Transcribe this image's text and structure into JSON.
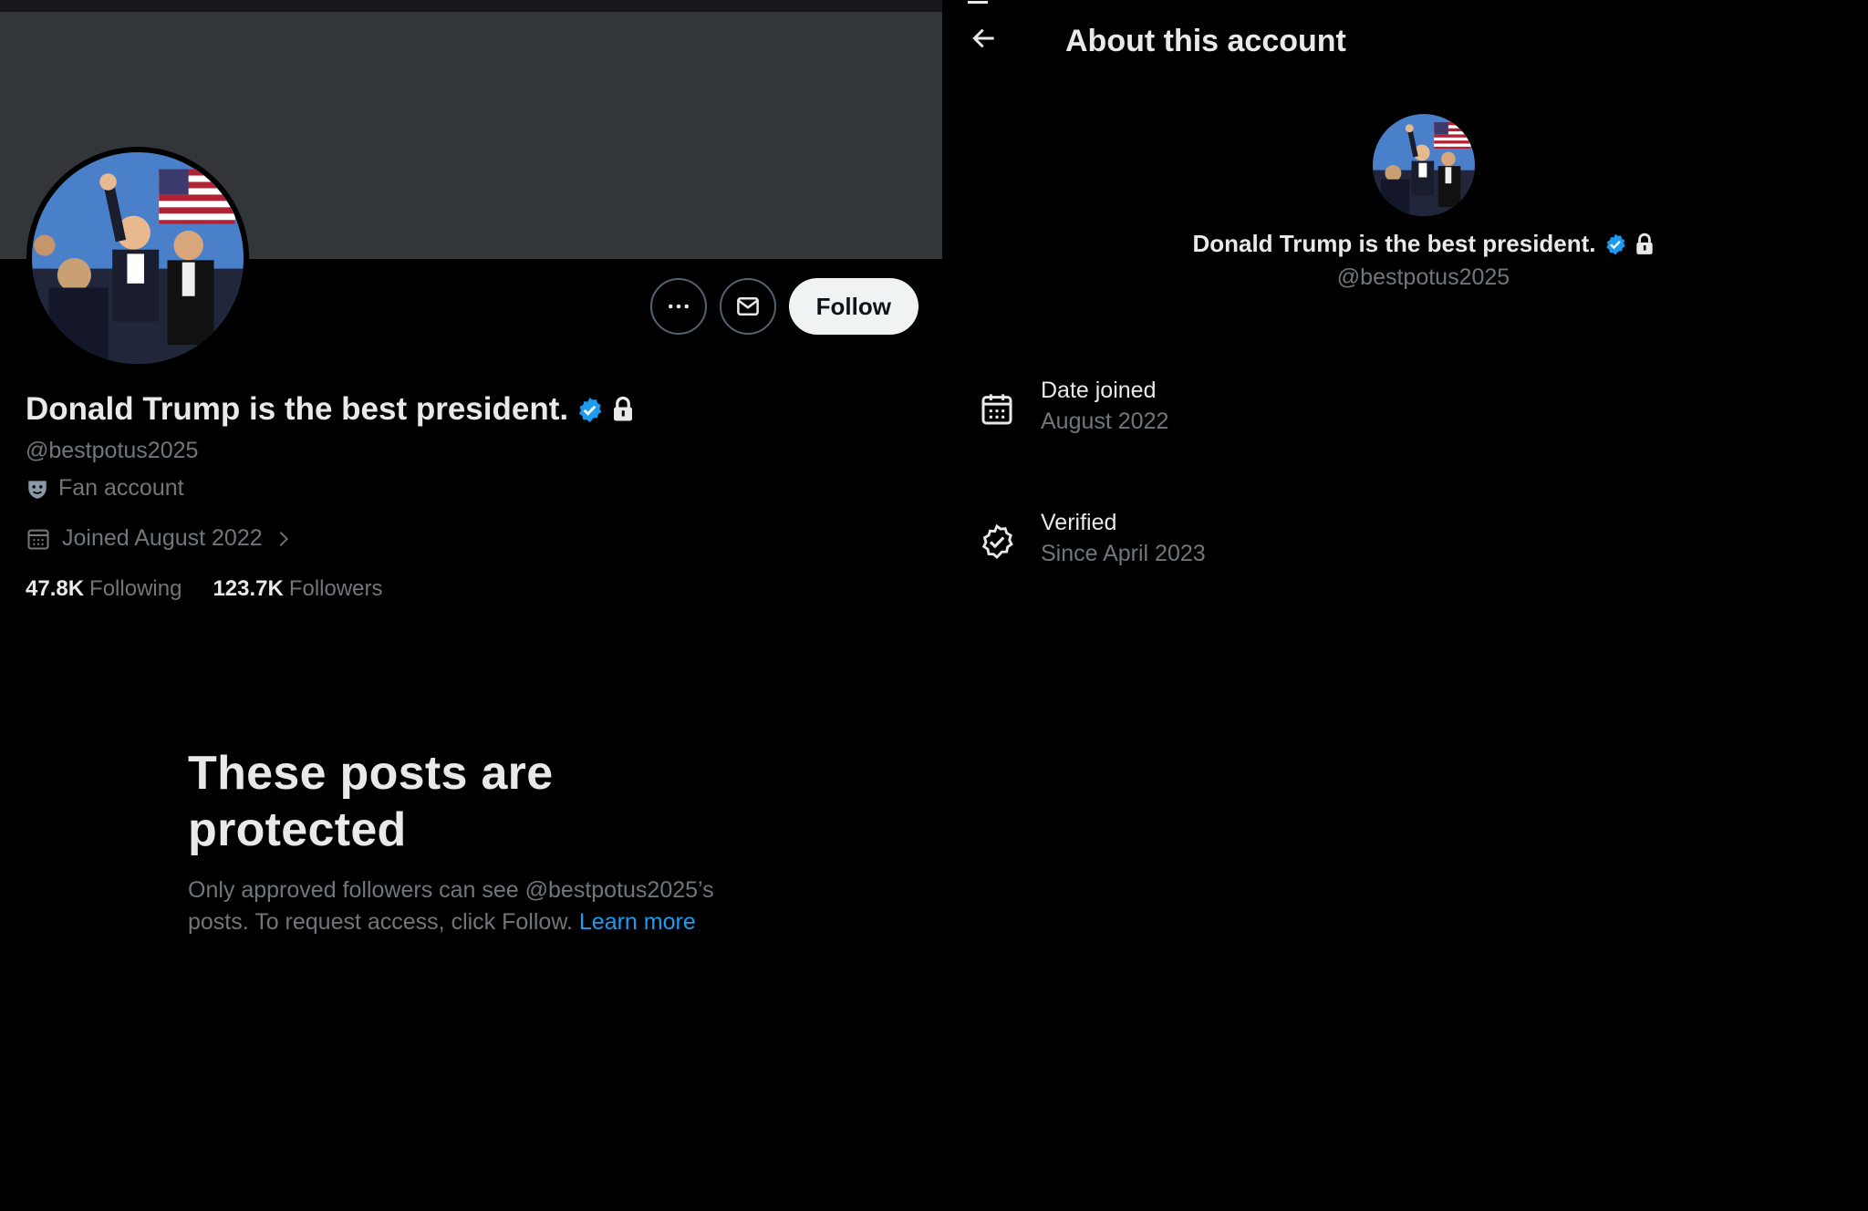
{
  "profile": {
    "display_name": "Donald Trump is the best president.",
    "handle": "@bestpotus2025",
    "category": "Fan account",
    "joined": "Joined August 2022",
    "following_count": "47.8K",
    "following_label": "Following",
    "followers_count": "123.7K",
    "followers_label": "Followers",
    "follow_label": "Follow"
  },
  "protected_notice": {
    "title": "These posts are protected",
    "body": "Only approved followers can see @bestpotus2025’s posts. To request access, click Follow.",
    "link": "Learn more"
  },
  "about": {
    "title": "About this account",
    "display_name": "Donald Trump is the best president.",
    "handle": "@bestpotus2025",
    "date_joined_label": "Date joined",
    "date_joined_value": "August 2022",
    "verified_label": "Verified",
    "verified_value": "Since April 2023"
  },
  "colors": {
    "background": "#000000",
    "banner": "#333639",
    "accent_blue": "#1d9bf0",
    "text_primary": "#e7e9ea",
    "text_secondary": "#71767b"
  },
  "icons": [
    "more-icon",
    "message-icon",
    "verified-badge-icon",
    "lock-icon",
    "mask-icon",
    "calendar-icon",
    "chevron-right-icon",
    "back-arrow-icon",
    "verified-outline-icon"
  ]
}
